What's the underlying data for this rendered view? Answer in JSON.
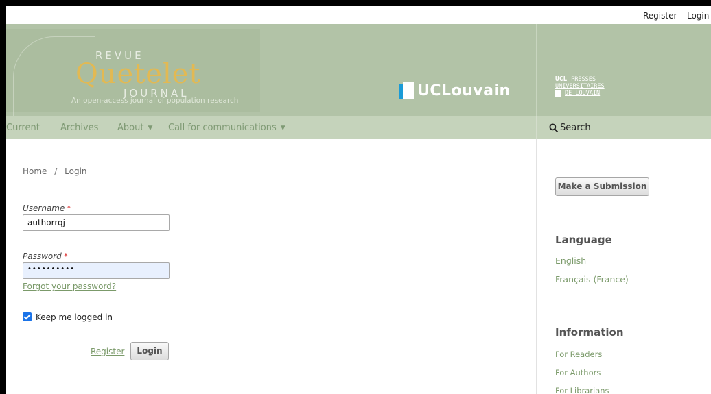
{
  "user_nav": {
    "register": "Register",
    "login": "Login"
  },
  "header": {
    "logo": {
      "revue": "REVUE",
      "quetelet": "Quetelet",
      "journal": "JOURNAL",
      "tagline": "An open-access journal of population research"
    },
    "uclouvain": "UCLouvain",
    "presses": {
      "line1a": "UCL",
      "line1b": "PRESSES",
      "line2": "UNIVERSITAIRES",
      "line3": "DE LOUVAIN"
    }
  },
  "primary_nav": {
    "items": [
      {
        "label": "Current"
      },
      {
        "label": "Archives"
      },
      {
        "label": "About"
      },
      {
        "label": "Call for communications"
      }
    ],
    "search": "Search"
  },
  "breadcrumb": {
    "home": "Home",
    "separator": "/",
    "current": "Login"
  },
  "form": {
    "username_label": "Username",
    "username_value": "authorrqj",
    "password_label": "Password",
    "password_value": "••••••••••",
    "required_mark": "*",
    "forgot": "Forgot your password?",
    "keep_logged_in": "Keep me logged in",
    "register": "Register",
    "login": "Login"
  },
  "sidebar": {
    "submit_button": "Make a Submission",
    "language_title": "Language",
    "languages": [
      "English",
      "Français (France)"
    ],
    "information_title": "Information",
    "information_links": [
      "For Readers",
      "For Authors",
      "For Librarians"
    ]
  },
  "colors": {
    "header_bg": "#b2c3a7",
    "nav_bg": "#c5d3bb",
    "link": "#7b9a6a",
    "logo_accent": "#e8b84b",
    "ucl_blue": "#1a9bd7"
  }
}
